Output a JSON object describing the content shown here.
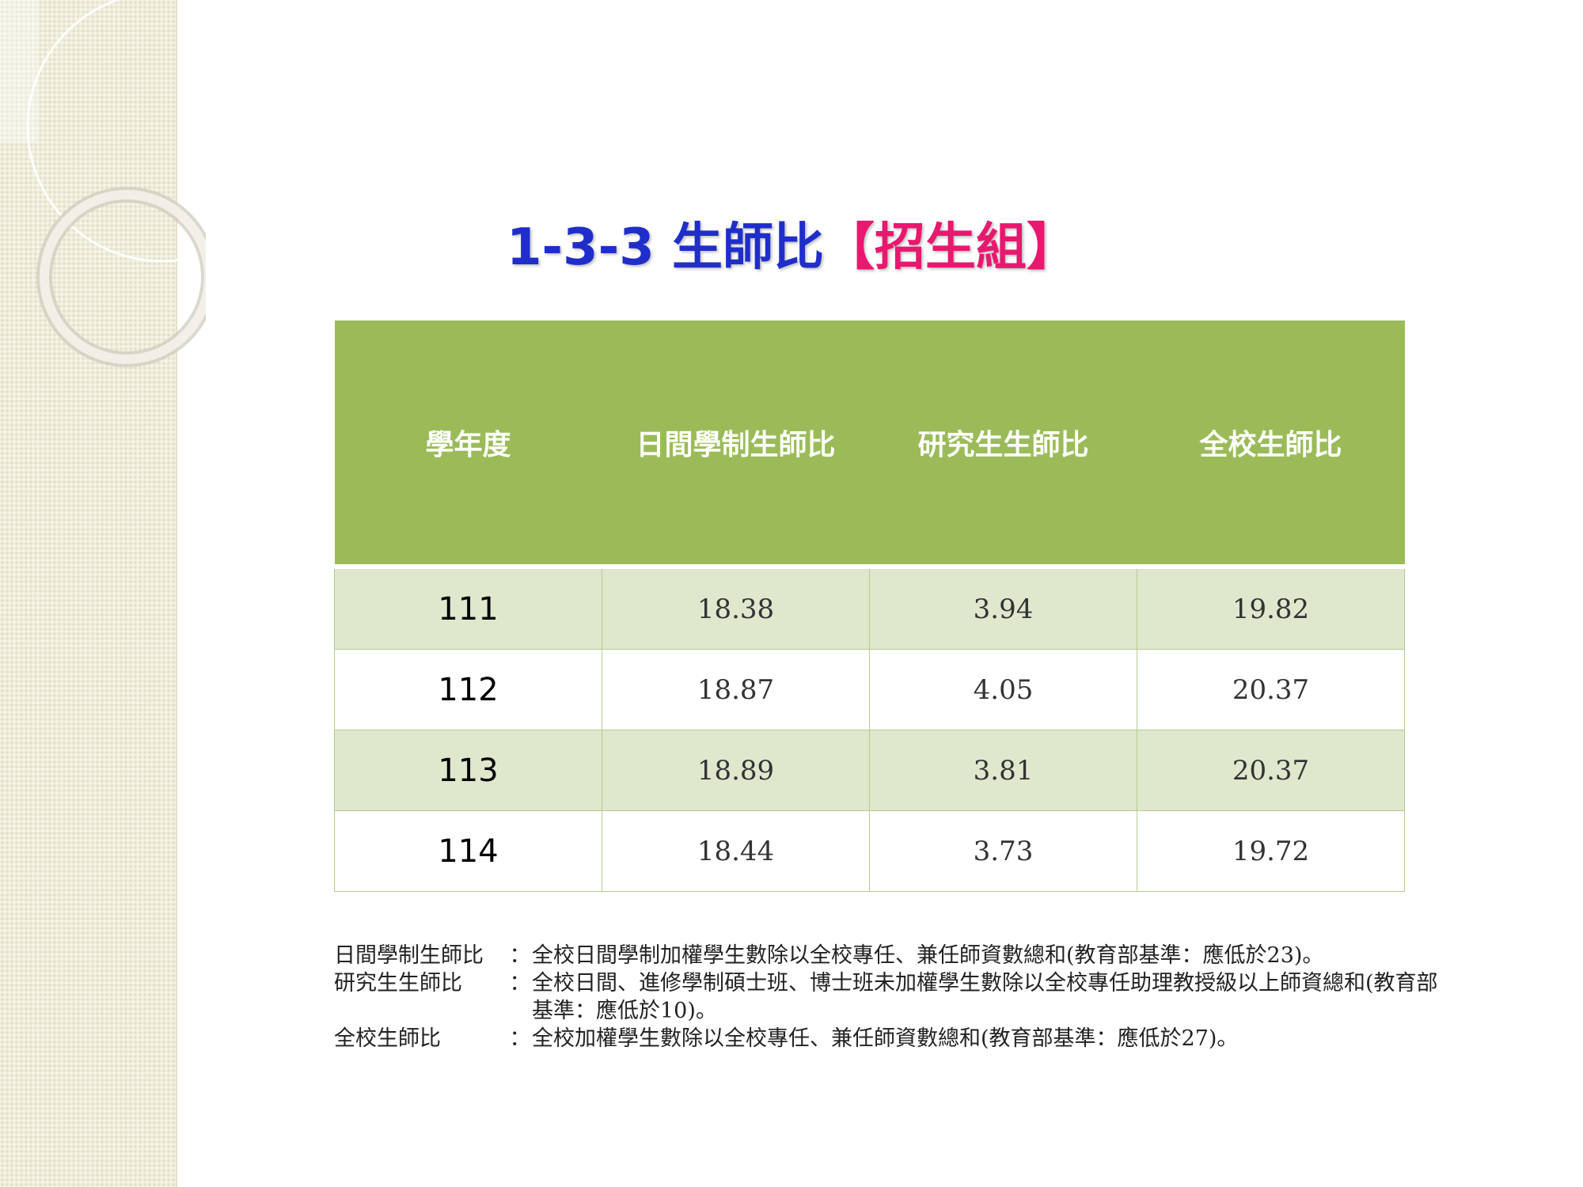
{
  "slide": {
    "title": "1-3-3 生師比",
    "group_label": "【招生組】"
  },
  "table": {
    "headers": [
      "學年度",
      "日間學制生師比",
      "研究生生師比",
      "全校生師比"
    ],
    "rows": [
      [
        "111",
        "18.38",
        "3.94",
        "19.82"
      ],
      [
        "112",
        "18.87",
        "4.05",
        "20.37"
      ],
      [
        "113",
        "18.89",
        "3.81",
        "20.37"
      ],
      [
        "114",
        "18.44",
        "3.73",
        "19.72"
      ]
    ]
  },
  "notes": [
    {
      "term": "日間學制生師比",
      "separator": "：",
      "definition": "全校日間學制加權學生數除以全校專任、兼任師資數總和(教育部基準：應低於23)。"
    },
    {
      "term": "研究生生師比",
      "separator": "：",
      "definition": "全校日間、進修學制碩士班、博士班未加權學生數除以全校專任助理教授級以上師資總和(教育部基準：應低於10)。"
    },
    {
      "term": "全校生師比",
      "separator": "：",
      "definition": "全校加權學生數除以全校專任、兼任師資數總和(教育部基準：應低於27)。"
    }
  ],
  "colors": {
    "header_green": "#9bbb59",
    "band_green": "#dfe7cd",
    "title_blue": "#1f2ec9",
    "title_pink": "#e8186f"
  }
}
